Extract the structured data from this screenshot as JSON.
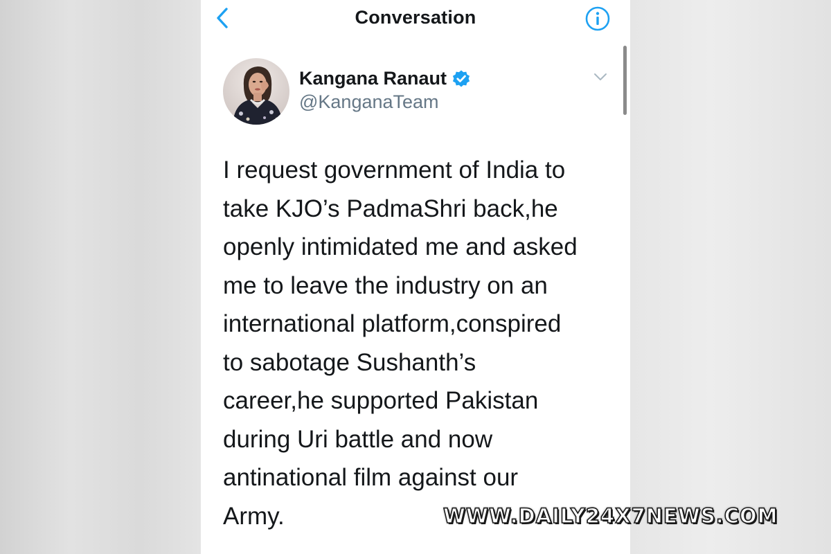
{
  "nav": {
    "title": "Conversation",
    "back_icon": "chevron-left-icon",
    "info_icon": "info-icon"
  },
  "tweet": {
    "author_name": "Kangana Ranaut",
    "handle": "@KanganaTeam",
    "verified": true,
    "text": "I request government of India to\ntake KJO’s PadmaShri back,he\nopenly intimidated me and asked\nme to leave the industry on an\ninternational platform,conspired\nto sabotage Sushanth’s\ncareer,he supported Pakistan\nduring Uri battle and now\nantinational film against our\nArmy."
  },
  "watermark": "WWW.DAILY24X7NEWS.COM",
  "colors": {
    "accent": "#1da1f2",
    "text": "#14171a",
    "secondary_text": "#657786",
    "background": "#ffffff"
  }
}
